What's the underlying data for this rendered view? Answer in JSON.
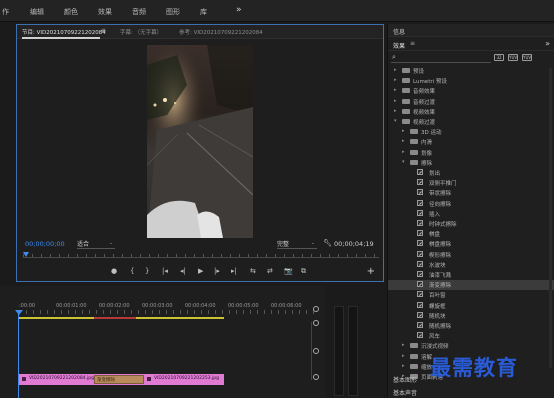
{
  "workspaces": [
    "作",
    "编辑",
    "颜色",
    "效果",
    "音频",
    "图形",
    "库"
  ],
  "workspace_more": "»",
  "monitor": {
    "tabs": [
      {
        "label": "节目: VID20210709221202084",
        "active": true
      },
      {
        "label": "字幕: （无字幕）",
        "active": false
      },
      {
        "label": "参考: VID20210709221202084",
        "active": false
      }
    ],
    "tab_menu": "≡",
    "timecode_current": "00;00;00;00",
    "fit_label": "适合",
    "quality_label": "完整",
    "timecode_duration": "00;00;04;19",
    "transport": [
      "●",
      "{",
      "}",
      "|◂",
      "◂|",
      "▶",
      "|▸",
      "▸|",
      "⇆",
      "⇄",
      "📷",
      "⧉"
    ],
    "add_button": "+"
  },
  "effects_panel": {
    "info_label": "信息",
    "tab_label": "效果",
    "tab_menu": "≡",
    "more": "»",
    "search_icon": "magnifier-icon",
    "tool_icons": [
      "32",
      "YUV",
      "YUV"
    ],
    "tree": [
      {
        "label": "预设",
        "level": 0,
        "kind": "folder",
        "expanded": false
      },
      {
        "label": "Lumetri 预设",
        "level": 0,
        "kind": "folder",
        "expanded": false
      },
      {
        "label": "音频效果",
        "level": 0,
        "kind": "folder",
        "expanded": false
      },
      {
        "label": "音频过渡",
        "level": 0,
        "kind": "folder",
        "expanded": false
      },
      {
        "label": "视频效果",
        "level": 0,
        "kind": "folder",
        "expanded": false
      },
      {
        "label": "视频过渡",
        "level": 0,
        "kind": "folder",
        "expanded": true
      },
      {
        "label": "3D 运动",
        "level": 1,
        "kind": "folder",
        "expanded": false
      },
      {
        "label": "内滑",
        "level": 1,
        "kind": "folder",
        "expanded": false
      },
      {
        "label": "划像",
        "level": 1,
        "kind": "folder",
        "expanded": false
      },
      {
        "label": "擦除",
        "level": 1,
        "kind": "folder",
        "expanded": true
      },
      {
        "label": "划出",
        "level": 2,
        "kind": "effect"
      },
      {
        "label": "双侧平推门",
        "level": 2,
        "kind": "effect"
      },
      {
        "label": "带状擦除",
        "level": 2,
        "kind": "effect"
      },
      {
        "label": "径向擦除",
        "level": 2,
        "kind": "effect"
      },
      {
        "label": "插入",
        "level": 2,
        "kind": "effect"
      },
      {
        "label": "时钟式擦除",
        "level": 2,
        "kind": "effect"
      },
      {
        "label": "棋盘",
        "level": 2,
        "kind": "effect"
      },
      {
        "label": "棋盘擦除",
        "level": 2,
        "kind": "effect"
      },
      {
        "label": "楔形擦除",
        "level": 2,
        "kind": "effect"
      },
      {
        "label": "水波块",
        "level": 2,
        "kind": "effect"
      },
      {
        "label": "油漆飞溅",
        "level": 2,
        "kind": "effect"
      },
      {
        "label": "渐变擦除",
        "level": 2,
        "kind": "effect",
        "selected": true
      },
      {
        "label": "百叶窗",
        "level": 2,
        "kind": "effect"
      },
      {
        "label": "螺旋框",
        "level": 2,
        "kind": "effect"
      },
      {
        "label": "随机块",
        "level": 2,
        "kind": "effect"
      },
      {
        "label": "随机擦除",
        "level": 2,
        "kind": "effect"
      },
      {
        "label": "风车",
        "level": 2,
        "kind": "effect"
      },
      {
        "label": "沉浸式视频",
        "level": 1,
        "kind": "folder",
        "expanded": false
      },
      {
        "label": "溶解",
        "level": 1,
        "kind": "folder",
        "expanded": false
      },
      {
        "label": "缩放",
        "level": 1,
        "kind": "folder",
        "expanded": false
      },
      {
        "label": "页面剥落",
        "level": 1,
        "kind": "folder",
        "expanded": false
      }
    ],
    "bottom_panels": [
      "基本图形",
      "基本声音"
    ]
  },
  "timeline": {
    "ruler_labels": [
      ":00:00",
      "00:00:01:00",
      "00:00:02:00",
      "00:00:03:00",
      "00:00:04:00",
      "00:00:05:00",
      "00:00:06:00"
    ],
    "clip_a": "VID20210709221202084.jpg",
    "transition": "渐变擦除",
    "clip_b": "VID20210709221202253.jpg"
  },
  "watermark": "最需教育",
  "colors": {
    "accent_blue": "#3f8cf0",
    "clip_pink": "#e07ad2",
    "work_area_yellow": "#c9c231",
    "watermark_blue": "#2a5bd6"
  }
}
